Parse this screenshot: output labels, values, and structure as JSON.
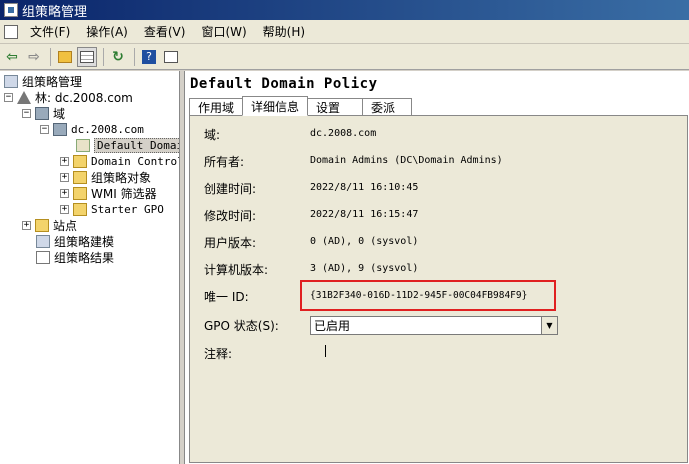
{
  "window": {
    "title": "组策略管理"
  },
  "menu": [
    "文件(F)",
    "操作(A)",
    "查看(V)",
    "窗口(W)",
    "帮助(H)"
  ],
  "toolbar": {
    "icons": [
      "back-arrow-icon",
      "forward-arrow-icon",
      "up-folder-icon",
      "show-tree-icon",
      "refresh-icon",
      "help-icon",
      "properties-icon"
    ]
  },
  "tree": {
    "root": "组策略管理",
    "forest": "林: dc.2008.com",
    "domains": "域",
    "domain": "dc.2008.com",
    "default_policy": "Default Domain",
    "domain_controllers": "Domain Control",
    "gpo_objects": "组策略对象",
    "wmi_filters": "WMI 筛选器",
    "starter_gpo": "Starter GPO",
    "sites": "站点",
    "modeling": "组策略建模",
    "results": "组策略结果"
  },
  "detail": {
    "title": "Default Domain Policy",
    "tabs": [
      "作用域",
      "详细信息",
      "设置",
      "委派"
    ],
    "active_tab": 1,
    "fields": {
      "domain_label": "域:",
      "domain_value": "dc.2008.com",
      "owner_label": "所有者:",
      "owner_value": "Domain Admins (DC\\Domain Admins)",
      "created_label": "创建时间:",
      "created_value": "2022/8/11 16:10:45",
      "modified_label": "修改时间:",
      "modified_value": "2022/8/11 16:15:47",
      "user_version_label": "用户版本:",
      "user_version_value": "0 (AD), 0 (sysvol)",
      "computer_version_label": "计算机版本:",
      "computer_version_value": "3 (AD), 9 (sysvol)",
      "unique_id_label": "唯一 ID:",
      "unique_id_value": "{31B2F340-016D-11D2-945F-00C04FB984F9}",
      "gpo_status_label": "GPO 状态(S):",
      "gpo_status_value": "已启用",
      "comment_label": "注释:"
    },
    "highlight_color": "#e02020"
  }
}
